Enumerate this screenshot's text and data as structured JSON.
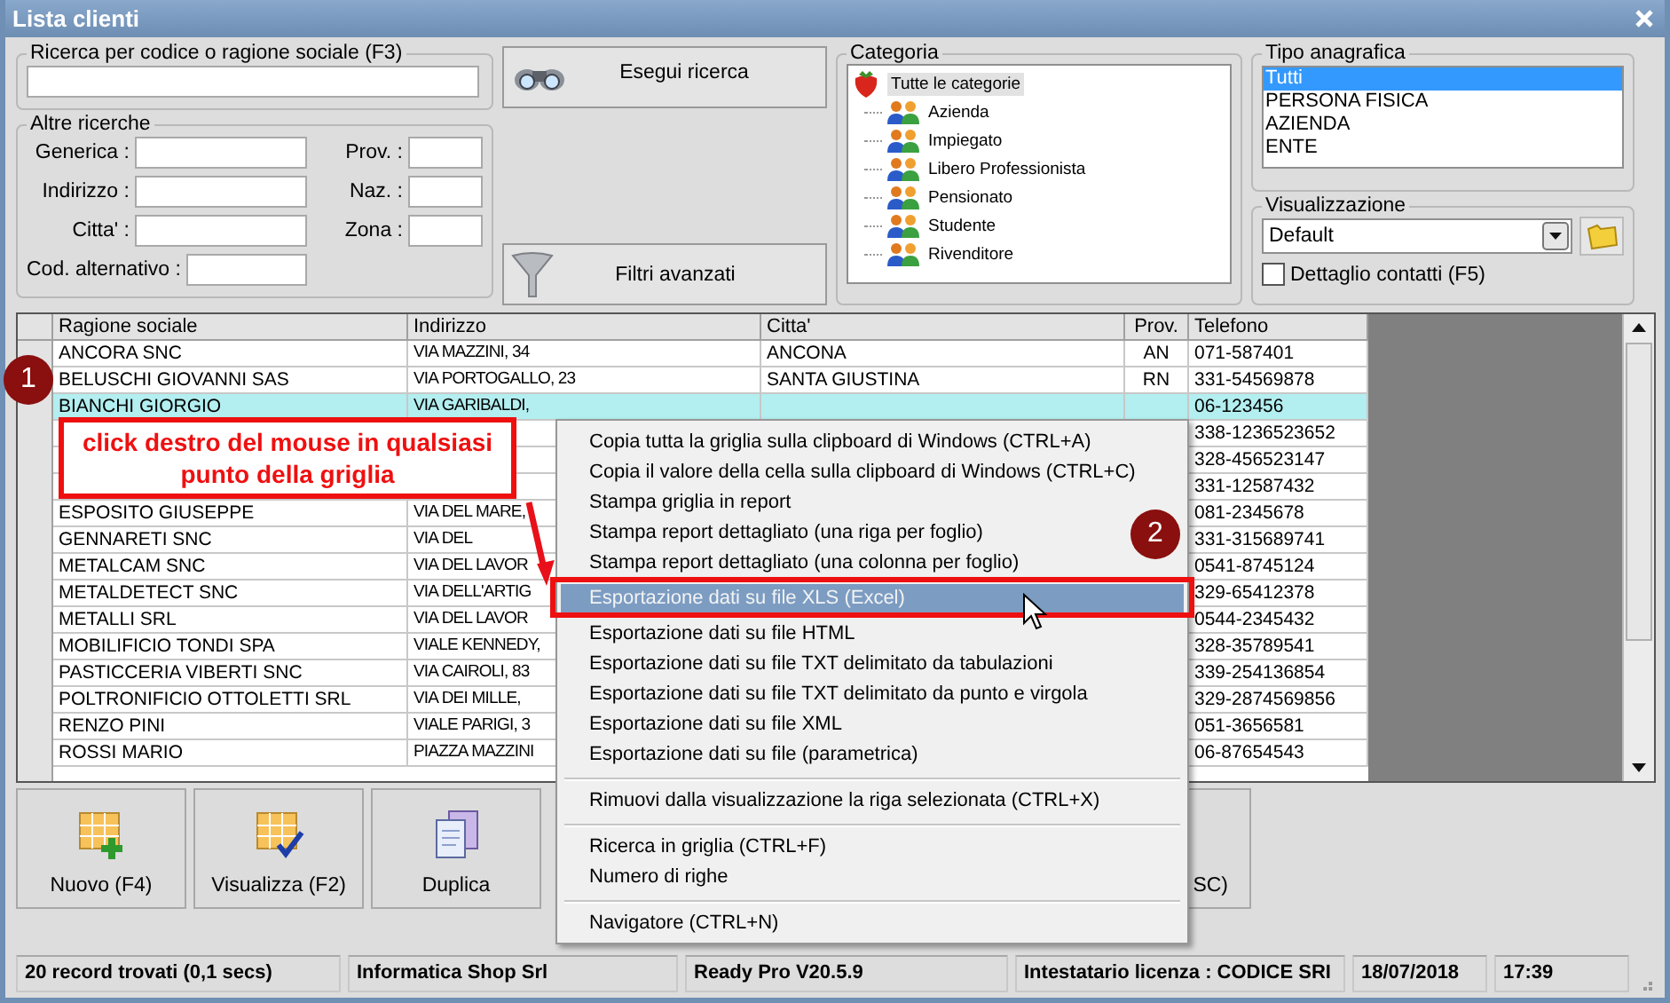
{
  "window": {
    "title": "Lista clienti"
  },
  "search": {
    "label": "Ricerca per codice o ragione sociale (F3)",
    "button": "Esegui ricerca"
  },
  "other_search": {
    "label": "Altre ricerche",
    "left_fields": [
      {
        "label": "Generica :"
      },
      {
        "label": "Indirizzo :"
      },
      {
        "label": "Citta' :"
      },
      {
        "label": "Cod. alternativo :"
      }
    ],
    "right_fields": [
      {
        "label": "Prov. :"
      },
      {
        "label": "Naz. :"
      },
      {
        "label": "Zona :"
      }
    ],
    "button": "Filtri avanzati"
  },
  "category": {
    "label": "Categoria",
    "root": {
      "label": "Tutte le categorie",
      "selected": true,
      "children": [
        {
          "label": "Azienda",
          "selected": false
        },
        {
          "label": "Impiegato",
          "selected": false
        },
        {
          "label": "Libero Professionista",
          "selected": false
        },
        {
          "label": "Pensionato",
          "selected": false
        },
        {
          "label": "Studente",
          "selected": false
        },
        {
          "label": "Rivenditore",
          "selected": false
        }
      ]
    }
  },
  "registry_type": {
    "label": "Tipo anagrafica",
    "items": [
      {
        "label": "Tutti",
        "selected": true
      },
      {
        "label": "PERSONA FISICA",
        "selected": false
      },
      {
        "label": "AZIENDA",
        "selected": false
      },
      {
        "label": "ENTE",
        "selected": false
      }
    ]
  },
  "view": {
    "label": "Visualizzazione",
    "value": "Default",
    "checkbox": {
      "label": "Dettaglio contatti (F5)",
      "checked": false
    }
  },
  "table": {
    "columns": [
      "Ragione sociale",
      "Indirizzo",
      "Citta'",
      "Prov.",
      "Telefono"
    ],
    "rows": [
      {
        "selected": false,
        "ragione_sociale": "ANCORA SNC",
        "indirizzo": "VIA MAZZINI, 34",
        "citta": "ANCONA",
        "prov": "AN",
        "telefono": "071-587401"
      },
      {
        "selected": false,
        "ragione_sociale": "BELUSCHI GIOVANNI SAS",
        "indirizzo": "VIA PORTOGALLO, 23",
        "citta": "SANTA GIUSTINA",
        "prov": "RN",
        "telefono": "331-54569878"
      },
      {
        "selected": true,
        "ragione_sociale": "BIANCHI GIORGIO",
        "indirizzo": "VIA GARIBALDI,",
        "telefono": "06-123456"
      },
      {
        "selected": false,
        "telefono": "338-1236523652"
      },
      {
        "selected": false,
        "telefono": "328-456523147"
      },
      {
        "selected": false,
        "telefono": "331-12587432"
      },
      {
        "selected": false,
        "ragione_sociale": "ESPOSITO GIUSEPPE",
        "indirizzo": "VIA DEL MARE,",
        "telefono": "081-2345678"
      },
      {
        "selected": false,
        "ragione_sociale": "GENNARETI SNC",
        "indirizzo": "VIA DEL",
        "telefono": "331-315689741"
      },
      {
        "selected": false,
        "ragione_sociale": "METALCAM SNC",
        "indirizzo": "VIA DEL LAVOR",
        "telefono": "0541-8745124"
      },
      {
        "selected": false,
        "ragione_sociale": "METALDETECT SNC",
        "indirizzo": "VIA DELL'ARTIG",
        "telefono": "329-65412378"
      },
      {
        "selected": false,
        "ragione_sociale": "METALLI SRL",
        "indirizzo": "VIA DEL LAVOR",
        "telefono": "0544-2345432"
      },
      {
        "selected": false,
        "ragione_sociale": "MOBILIFICIO TONDI SPA",
        "indirizzo": "VIALE KENNEDY,",
        "telefono": "328-35789541"
      },
      {
        "selected": false,
        "ragione_sociale": "PASTICCERIA VIBERTI SNC",
        "indirizzo": "VIA CAIROLI, 83",
        "telefono": "339-254136854"
      },
      {
        "selected": false,
        "ragione_sociale": "POLTRONIFICIO OTTOLETTI SRL",
        "indirizzo": "VIA DEI MILLE,",
        "telefono": "329-2874569856"
      },
      {
        "selected": false,
        "ragione_sociale": "RENZO PINI",
        "indirizzo": "VIALE PARIGI, 3",
        "telefono": "051-3656581"
      },
      {
        "selected": false,
        "ragione_sociale": "ROSSI MARIO",
        "indirizzo": "PIAZZA MAZZINI",
        "telefono": "06-87654543"
      }
    ]
  },
  "buttons": [
    {
      "label": "Nuovo (F4)",
      "kind": "new"
    },
    {
      "label": "Visualizza (F2)",
      "kind": "view"
    },
    {
      "label": "Duplica",
      "kind": "copy"
    },
    {
      "label": "SC)",
      "kind": "plain"
    }
  ],
  "context_menu": {
    "items": [
      {
        "kind": "item",
        "label": "Copia tutta la griglia sulla clipboard di Windows (CTRL+A)",
        "selected": false
      },
      {
        "kind": "item",
        "label": "Copia il valore della cella sulla clipboard di Windows (CTRL+C)",
        "selected": false
      },
      {
        "kind": "item",
        "label": "Stampa griglia in report",
        "selected": false
      },
      {
        "kind": "item",
        "label": "Stampa report dettagliato (una riga per foglio)",
        "selected": false
      },
      {
        "kind": "item",
        "label": "Stampa report dettagliato (una colonna per foglio)",
        "selected": false
      },
      {
        "kind": "item",
        "label": "Esportazione dati su file XLS (Excel)",
        "selected": true
      },
      {
        "kind": "item",
        "label": "Esportazione dati su file HTML",
        "selected": false
      },
      {
        "kind": "item",
        "label": "Esportazione dati su file TXT delimitato da tabulazioni",
        "selected": false
      },
      {
        "kind": "item",
        "label": "Esportazione dati su file TXT delimitato da punto e virgola",
        "selected": false
      },
      {
        "kind": "item",
        "label": "Esportazione dati su file XML",
        "selected": false
      },
      {
        "kind": "item",
        "label": "Esportazione dati su file (parametrica)",
        "selected": false
      },
      {
        "kind": "separator"
      },
      {
        "kind": "item",
        "label": "Rimuovi dalla visualizzazione la riga selezionata (CTRL+X)",
        "selected": false
      },
      {
        "kind": "separator"
      },
      {
        "kind": "item",
        "label": "Ricerca in griglia (CTRL+F)",
        "selected": false
      },
      {
        "kind": "item",
        "label": "Numero di righe",
        "selected": false
      },
      {
        "kind": "separator"
      },
      {
        "kind": "item",
        "label": "Navigatore (CTRL+N)",
        "selected": false
      }
    ]
  },
  "annotations": {
    "callout": "click destro del mouse in qualsiasi punto della griglia",
    "badges": [
      "1",
      "2"
    ]
  },
  "status_bar": [
    "20 record trovati (0,1 secs)",
    "Informatica Shop Srl",
    "Ready Pro V20.5.9",
    "Intestatario licenza : CODICE SRI",
    "18/07/2018",
    "17:39"
  ]
}
